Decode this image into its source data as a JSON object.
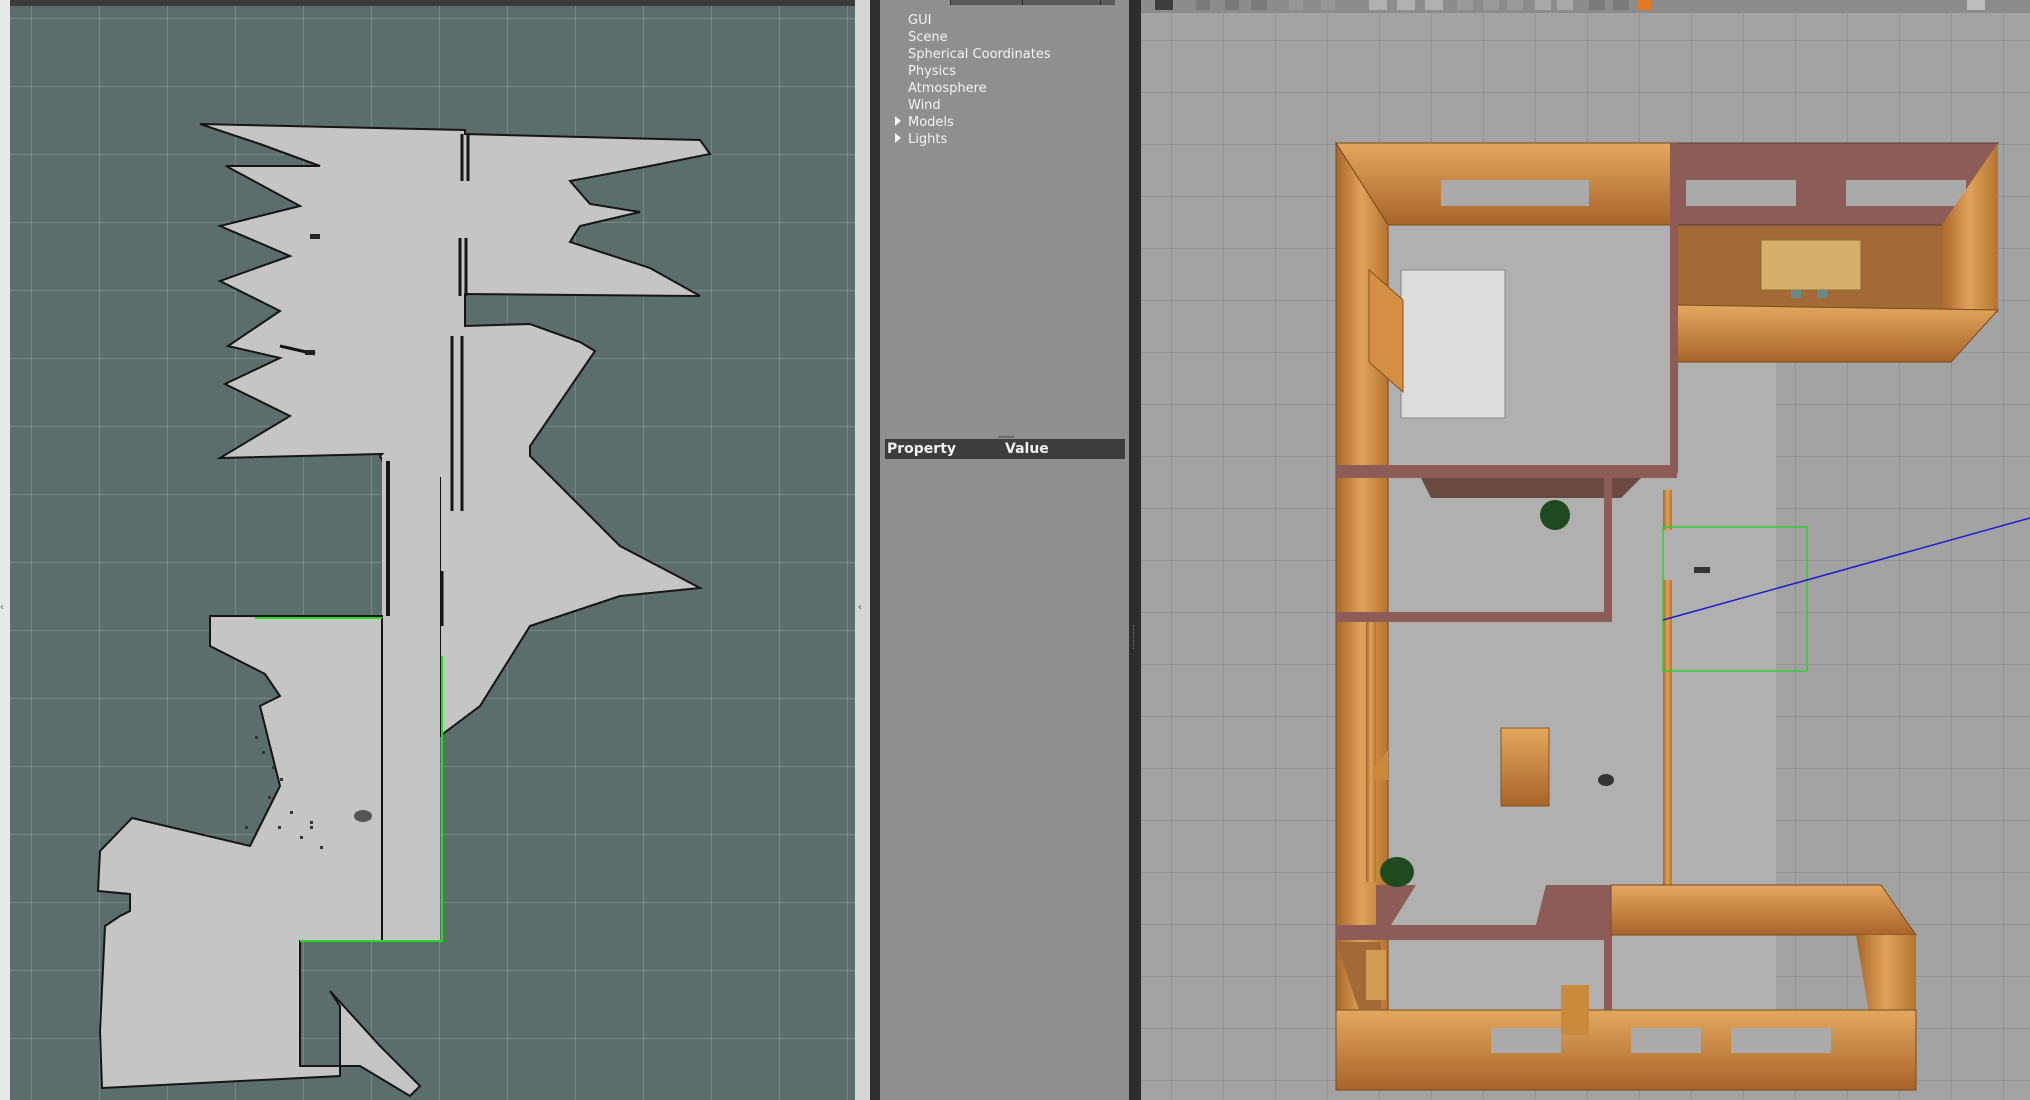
{
  "rviz": {
    "colors": {
      "unknown": "#5b6e6c",
      "free": "#c5c5c5",
      "occupied": "#111111",
      "laser": "#22dd22",
      "grid": "#8fa3a1"
    }
  },
  "gazebo": {
    "world_tree": {
      "items": [
        {
          "label": "GUI",
          "expandable": false
        },
        {
          "label": "Scene",
          "expandable": false
        },
        {
          "label": "Spherical Coordinates",
          "expandable": false
        },
        {
          "label": "Physics",
          "expandable": false
        },
        {
          "label": "Atmosphere",
          "expandable": false
        },
        {
          "label": "Wind",
          "expandable": false
        },
        {
          "label": "Models",
          "expandable": true
        },
        {
          "label": "Lights",
          "expandable": true
        }
      ]
    },
    "properties": {
      "col_property": "Property",
      "col_value": "Value"
    },
    "toolbar": {
      "icons": [
        "select-icon",
        "translate-icon",
        "rotate-icon",
        "scale-icon",
        "undo-icon",
        "redo-icon",
        "box-icon",
        "sphere-icon",
        "cylinder-icon",
        "point-light-icon",
        "spot-light-icon",
        "directional-light-icon",
        "copy-icon",
        "paste-icon",
        "align-icon",
        "snap-icon",
        "change-view-icon",
        "screenshot-icon"
      ]
    },
    "colors": {
      "ground": "#a2a2a2",
      "grid": "#8d8d8d",
      "wood": "#c98a3c",
      "brick": "#8a5a58",
      "laser_line": "#1d1dcc",
      "selection_box": "#22cc22"
    }
  }
}
